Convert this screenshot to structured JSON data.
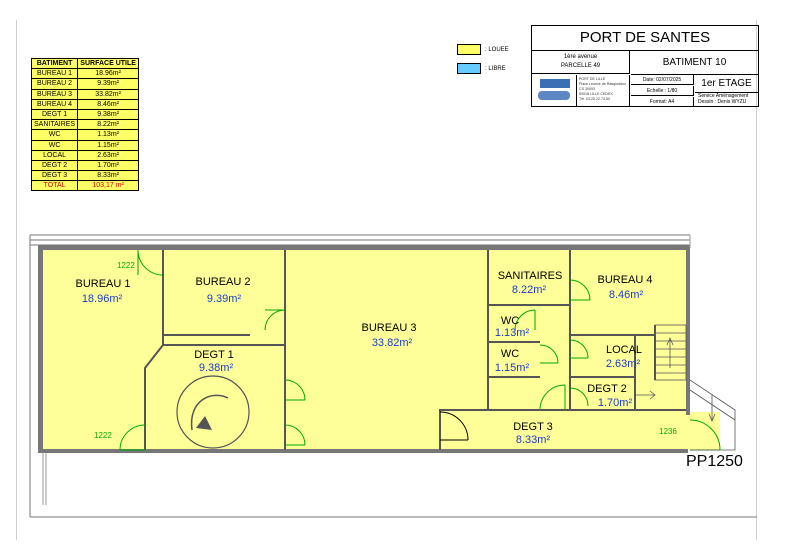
{
  "surface_table": {
    "header": {
      "name": "BATIMENT",
      "area": "SURFACE UTILE"
    },
    "rows": [
      {
        "name": "BUREAU 1",
        "area": "18.96m²"
      },
      {
        "name": "BUREAU 2",
        "area": "9.39m²"
      },
      {
        "name": "BUREAU 3",
        "area": "33.82m²"
      },
      {
        "name": "BUREAU 4",
        "area": "8.46m²"
      },
      {
        "name": "DEGT 1",
        "area": "9.38m²"
      },
      {
        "name": "SANITAIRES",
        "area": "8.22m²"
      },
      {
        "name": "WC",
        "area": "1.13m²"
      },
      {
        "name": "WC",
        "area": "1.15m²"
      },
      {
        "name": "LOCAL",
        "area": "2.63m²"
      },
      {
        "name": "DEGT 2",
        "area": "1.70m²"
      },
      {
        "name": "DEGT 3",
        "area": "8.33m²"
      }
    ],
    "total": {
      "name": "TOTAL",
      "area": "103,17 m²"
    }
  },
  "legend": {
    "louee": {
      "label": ": LOUEE",
      "color": "#ffff66"
    },
    "libre": {
      "label": ": LIBRE",
      "color": "#66ccff"
    }
  },
  "cartouche": {
    "title": "PORT DE SANTES",
    "address_line1": "1ère avenue",
    "address_line2": "PARCELLE 49",
    "building": "BATIMENT 10",
    "contact_lines": [
      "PORT DE LILLE",
      "Place Leonce de Rasquetdon",
      "CS 30093",
      "59018 LILLE CEDEX",
      "Tél. 03.20.22.73.50"
    ],
    "date": "Date: 02/07/2025",
    "scale": "Echelle : 1/80",
    "format": "Format: A4",
    "floor": "1er ETAGE",
    "service_line1": "Service Aménagement",
    "service_line2": "Dessin : Denis WYZU"
  },
  "plan": {
    "fill_color": "#ffff99",
    "rooms": [
      {
        "name": "BUREAU 1",
        "area": "18.96m²"
      },
      {
        "name": "BUREAU 2",
        "area": "9.39m²"
      },
      {
        "name": "BUREAU 3",
        "area": "33.82m²"
      },
      {
        "name": "BUREAU 4",
        "area": "8.46m²"
      },
      {
        "name": "DEGT 1",
        "area": "9.38m²"
      },
      {
        "name": "SANITAIRES",
        "area": "8.22m²"
      },
      {
        "name": "WC",
        "area": "1.13m²"
      },
      {
        "name": "WC",
        "area": "1.15m²"
      },
      {
        "name": "LOCAL",
        "area": "2.63m²"
      },
      {
        "name": "DEGT 2",
        "area": "1.70m²"
      },
      {
        "name": "DEGT 3",
        "area": "8.33m²"
      }
    ],
    "door_codes": [
      "1222",
      "1222",
      "1236"
    ],
    "plan_ref": "PP1250"
  }
}
